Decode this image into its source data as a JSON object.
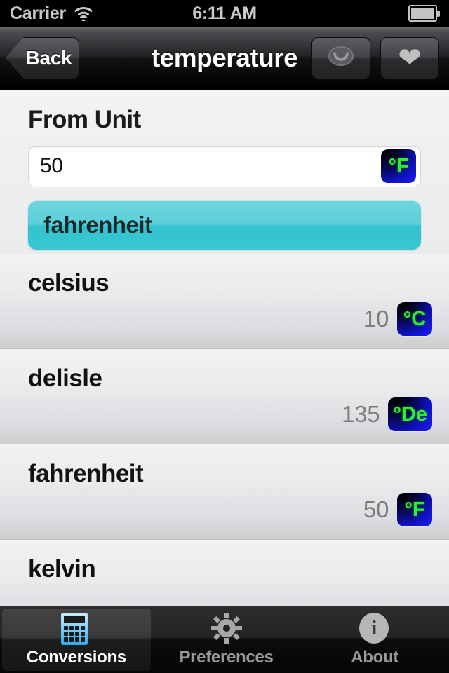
{
  "status_bar": {
    "carrier": "Carrier",
    "wifi_icon": "wifi-icon",
    "time": "6:11 AM",
    "battery_icon": "battery-full-icon"
  },
  "nav_bar": {
    "back_label": "Back",
    "title": "temperature",
    "eye_icon": "eye-icon",
    "favorite_icon": "heart-icon"
  },
  "from_unit": {
    "label": "From Unit",
    "input_value": "50",
    "input_placeholder": "",
    "input_badge": "°F",
    "selected_unit": "fahrenheit"
  },
  "conversions": [
    {
      "name": "celsius",
      "value": "10",
      "badge": "°C"
    },
    {
      "name": "delisle",
      "value": "135",
      "badge": "°De"
    },
    {
      "name": "fahrenheit",
      "value": "50",
      "badge": "°F"
    },
    {
      "name": "kelvin",
      "value": "",
      "badge": ""
    }
  ],
  "tab_bar": {
    "tabs": [
      {
        "label": "Conversions",
        "icon": "calculator-icon",
        "active": true
      },
      {
        "label": "Preferences",
        "icon": "gear-icon",
        "active": false
      },
      {
        "label": "About",
        "icon": "info-icon",
        "active": false
      }
    ]
  },
  "colors": {
    "accent_cyan": "#4ecbd6",
    "badge_blue": "#1b1ef5",
    "badge_green": "#2bf02b",
    "tab_active_text": "#ffffff"
  }
}
